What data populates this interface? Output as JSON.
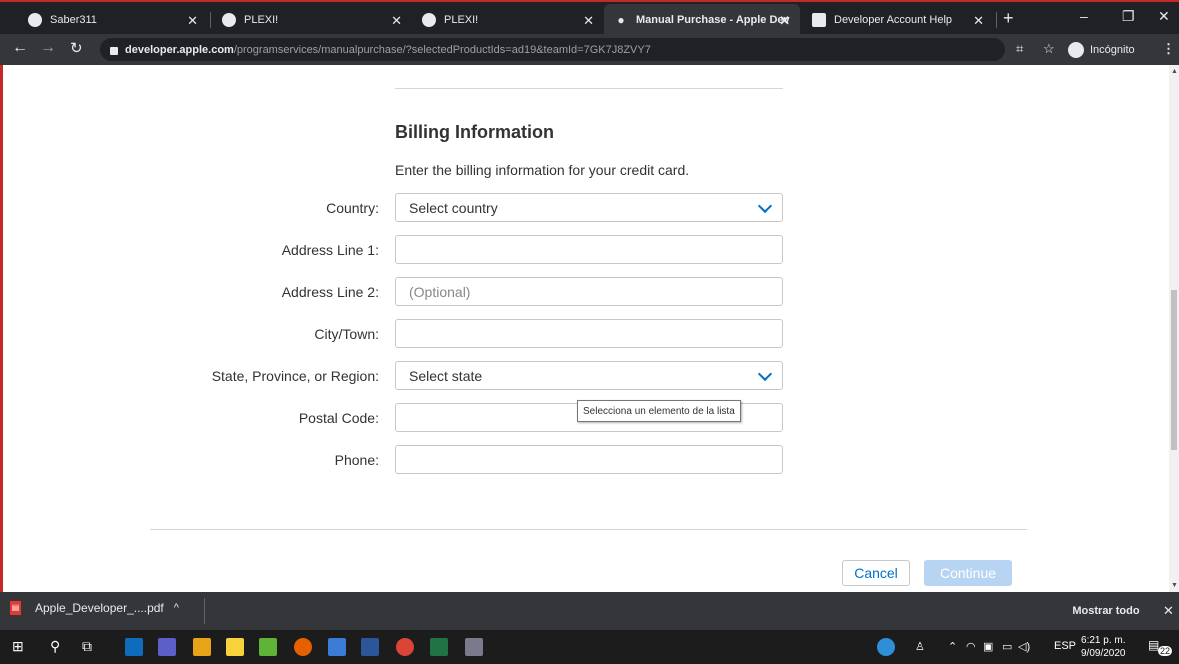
{
  "browser": {
    "tabs": [
      {
        "label": "Saber311",
        "icon": "globe-icon"
      },
      {
        "label": "PLEXI!",
        "icon": "globe-icon"
      },
      {
        "label": "PLEXI!",
        "icon": "globe-icon"
      },
      {
        "label": "Manual Purchase - Apple Deve",
        "icon": "apple-icon",
        "active": true
      },
      {
        "label": "Developer Account Help",
        "icon": "apple-square-icon"
      }
    ],
    "url_host": "developer.apple.com",
    "url_path": "/programservices/manualpurchase/?selectedProductIds=ad19&teamId=7GK7J8ZVY7",
    "incognito_label": "Incógnito"
  },
  "page": {
    "heading": "Billing Information",
    "intro": "Enter the billing information for your credit card.",
    "fields": {
      "country": {
        "label": "Country:",
        "value": "Select country"
      },
      "address1": {
        "label": "Address Line 1:",
        "value": ""
      },
      "address2": {
        "label": "Address Line 2:",
        "placeholder": "(Optional)"
      },
      "city": {
        "label": "City/Town:",
        "value": ""
      },
      "state": {
        "label": "State, Province, or Region:",
        "value": "Select state"
      },
      "postal": {
        "label": "Postal Code:",
        "value": ""
      },
      "phone": {
        "label": "Phone:",
        "value": ""
      }
    },
    "tooltip": "Selecciona un elemento de la lista",
    "cancel_label": "Cancel",
    "continue_label": "Continue",
    "colors": {
      "accent": "#0070c9",
      "continue_disabled": "#b7d5f3"
    }
  },
  "downloads": {
    "file_name": "Apple_Developer_....pdf",
    "show_all_label": "Mostrar todo"
  },
  "taskbar": {
    "lang": "ESP",
    "time": "6:21 p. m.",
    "date": "9/09/2020",
    "notifications": "22"
  }
}
